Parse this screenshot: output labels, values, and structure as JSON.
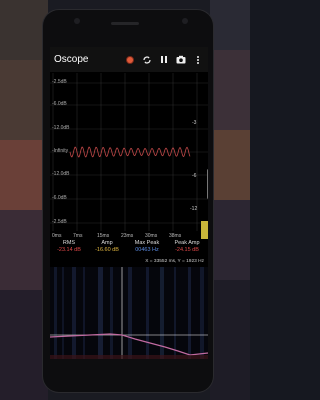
{
  "app": {
    "title": "Oscope"
  },
  "toolbar": {
    "record_icon": "record-dot-icon",
    "sync_icon": "sync-icon",
    "pause_icon": "pause-icon",
    "camera_icon": "camera-icon",
    "menu_icon": "overflow-menu-icon"
  },
  "scope": {
    "y_labels_left": [
      "-2.5dB",
      "-6.0dB",
      "-12.0dB",
      "-Infinity",
      "-12.0dB",
      "-6.0dB",
      "-2.5dB"
    ],
    "y_labels_right": [
      "-3",
      "-6",
      "-12"
    ],
    "x_labels": [
      "0ms",
      "7ms",
      "15ms",
      "23ms",
      "30ms",
      "38ms"
    ]
  },
  "stats": {
    "rms_label": "RMS",
    "rms_value": "-23.14 dB",
    "amp_label": "Amp",
    "amp_value": "-16.60 dB",
    "maxpeak_label": "Max Peak",
    "maxpeak_value": "00463 Hz",
    "peakamp_label": "Peak Amp",
    "peakamp_value": "-24.15 dB",
    "coordinates": "X = 33552 ms, Y = 1923 Hz"
  },
  "colors": {
    "waveform": "#c04848",
    "spectrum_line": "#c06aa0",
    "red_value": "#e04848",
    "yellow_value": "#e0b640",
    "blue_value": "#5a8ae0"
  }
}
